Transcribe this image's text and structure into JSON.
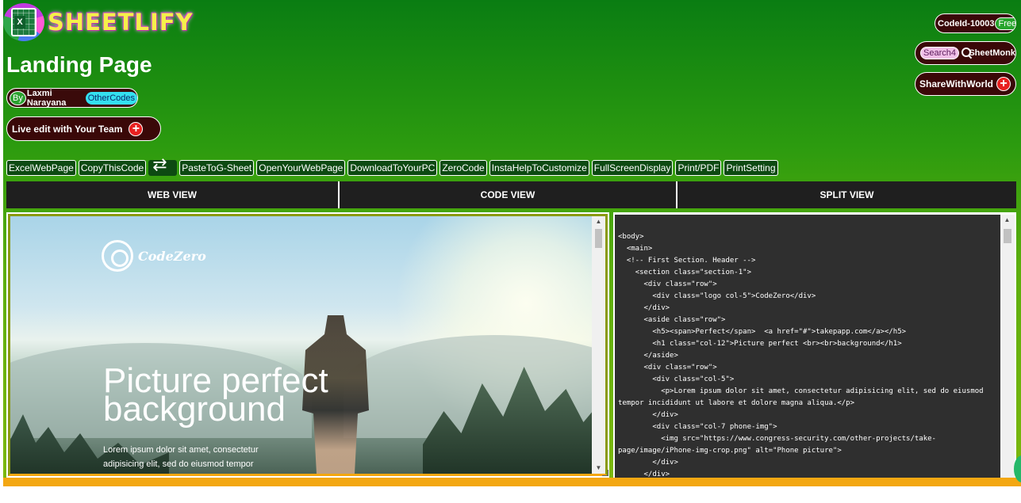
{
  "brand": {
    "name": "SHEETLIFY",
    "logo_icon": "excel-sheet-icon"
  },
  "page": {
    "title": "Landing Page"
  },
  "author": {
    "by": "By",
    "name": "Laxmi Narayana",
    "other_codes": "OtherCodes"
  },
  "live_edit": {
    "label": "Live edit with Your Team"
  },
  "right": {
    "code_id": "CodeId-10003",
    "free": "Free",
    "search_badge": "Search4",
    "sheetmonk": "SheetMonk",
    "share": "ShareWithWorld"
  },
  "toolbar": {
    "items": [
      "ExcelWebPage",
      "CopyThisCode",
      "PasteToG-Sheet",
      "OpenYourWebPage",
      "DownloadToYourPC",
      "ZeroCode",
      "InstaHelpToCustomize",
      "FullScreenDisplay",
      "Print/PDF",
      "PrintSetting"
    ]
  },
  "tabs": [
    "WEB VIEW",
    "CODE VIEW",
    "SPLIT VIEW"
  ],
  "preview": {
    "brand": "CodeZero",
    "title_line1": "Picture perfect",
    "title_line2": "background",
    "text_line1": "Lorem ipsum dolor sit amet, consectetur",
    "text_line2": "adipisicing elit, sed do eiusmod tempor"
  },
  "code_lines": [
    "<body>",
    "  <main>",
    "  <!-- First Section. Header -->",
    "    <section class=\"section-1\">",
    "      <div class=\"row\">",
    "        <div class=\"logo col-5\">CodeZero</div>",
    "      </div>",
    "      <aside class=\"row\">",
    "        <h5><span>Perfect</span>  <a href=\"#\">takepapp.com</a></h5>",
    "        <h1 class=\"col-12\">Picture perfect <br><br>background</h1>",
    "      </aside>",
    "      <div class=\"row\">",
    "        <div class=\"col-5\">",
    "          <p>Lorem ipsum dolor sit amet, consectetur adipisicing elit, sed do eiusmod tempor incididunt ut labore et dolore magna aliqua.</p>",
    "        </div>",
    "        <div class=\"col-7 phone-img\">",
    "          <img src=\"https://www.congress-security.com/other-projects/take-page/image/iPhone-img-crop.png\" alt=\"Phone picture\">",
    "        </div>",
    "      </div>"
  ],
  "colors": {
    "header_green": "#0a7d12",
    "accent_yellow": "#f3a712",
    "pill_dark": "#3a0808",
    "code_bg": "#2f2f2f"
  }
}
